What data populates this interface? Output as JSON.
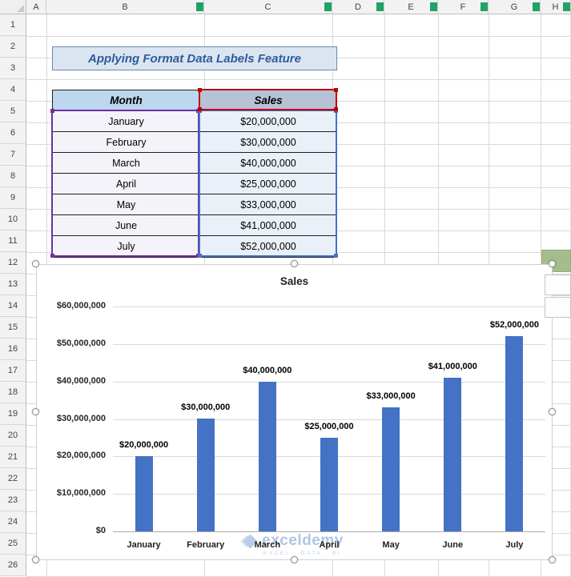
{
  "sheet": {
    "column_headers": [
      "A",
      "B",
      "C",
      "D",
      "E",
      "F",
      "G",
      "H"
    ],
    "row_headers": [
      "1",
      "2",
      "3",
      "4",
      "5",
      "6",
      "7",
      "8",
      "9",
      "10",
      "11",
      "12",
      "13",
      "14",
      "15",
      "16",
      "17",
      "18",
      "19",
      "20",
      "21",
      "22",
      "23",
      "24",
      "25",
      "26"
    ]
  },
  "banner": {
    "text": "Applying Format Data Labels Feature"
  },
  "table": {
    "headers": {
      "month": "Month",
      "sales": "Sales"
    },
    "rows": [
      {
        "month": "January",
        "sales": "$20,000,000"
      },
      {
        "month": "February",
        "sales": "$30,000,000"
      },
      {
        "month": "March",
        "sales": "$40,000,000"
      },
      {
        "month": "April",
        "sales": "$25,000,000"
      },
      {
        "month": "May",
        "sales": "$33,000,000"
      },
      {
        "month": "June",
        "sales": "$41,000,000"
      },
      {
        "month": "July",
        "sales": "$52,000,000"
      }
    ]
  },
  "chart_data": {
    "type": "bar",
    "title": "Sales",
    "categories": [
      "January",
      "February",
      "March",
      "April",
      "May",
      "June",
      "July"
    ],
    "values": [
      20000000,
      30000000,
      40000000,
      25000000,
      33000000,
      41000000,
      52000000
    ],
    "data_labels": [
      "$20,000,000",
      "$30,000,000",
      "$40,000,000",
      "$25,000,000",
      "$33,000,000",
      "$41,000,000",
      "$52,000,000"
    ],
    "y_ticks": [
      "$60,000,000",
      "$50,000,000",
      "$40,000,000",
      "$30,000,000",
      "$20,000,000",
      "$10,000,000",
      "$0"
    ],
    "ylim": [
      0,
      60000000
    ],
    "xlabel": "",
    "ylabel": "",
    "grid": true,
    "legend": "none",
    "bar_color": "#4472C4"
  },
  "watermark": {
    "brand": "exceldemy",
    "tagline": "EXCEL · DATA · BI"
  },
  "colors": {
    "bar": "#4472C4",
    "category_range_highlight": "#7030A0",
    "value_range_highlight": "#4472C4",
    "series_name_highlight": "#C00000",
    "header_accent_green": "#21A366"
  }
}
